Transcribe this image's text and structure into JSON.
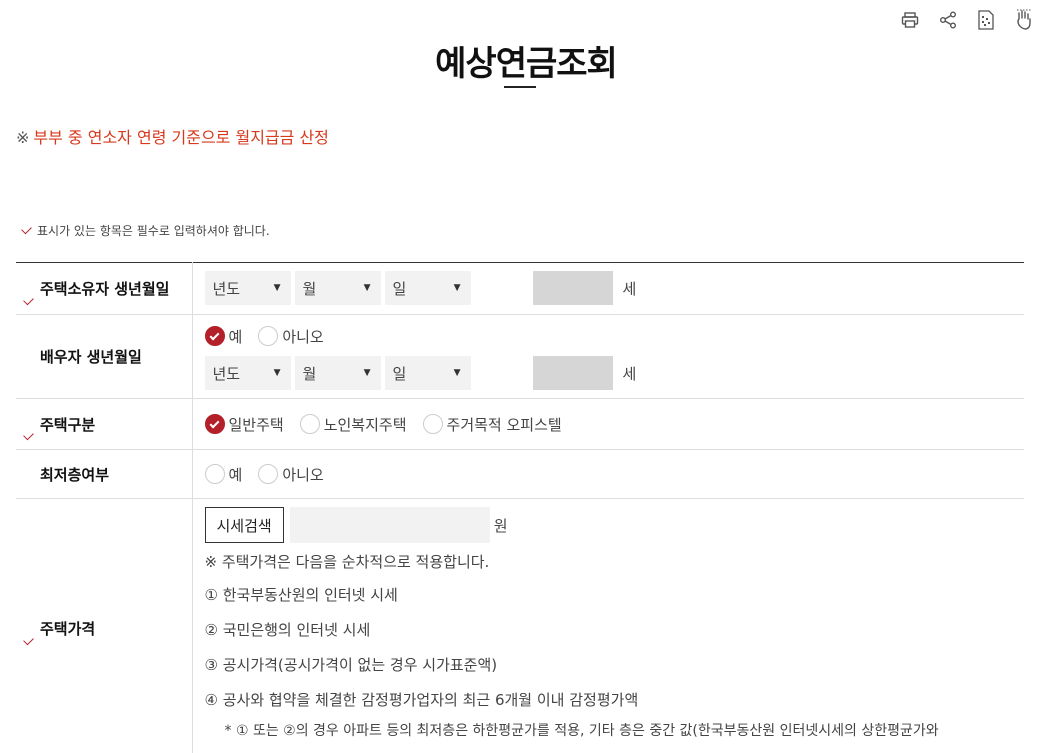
{
  "toolbar": {
    "print": "print-icon",
    "share": "share-icon",
    "qr": "qr-code-icon",
    "sign": "sign-language-icon"
  },
  "page": {
    "title": "예상연금조회",
    "notice_mark": "※",
    "notice": "부부 중 연소자 연령 기준으로 월지급금 산정",
    "required_note": "표시가 있는 항목은 필수로 입력하셔야 합니다."
  },
  "form": {
    "owner_birth": {
      "label": "주택소유자 생년월일",
      "year": "년도",
      "month": "월",
      "day": "일",
      "age_unit": "세"
    },
    "spouse_birth": {
      "label": "배우자 생년월일",
      "yes": "예",
      "no": "아니오",
      "year": "년도",
      "month": "월",
      "day": "일",
      "age_unit": "세"
    },
    "house_type": {
      "label": "주택구분",
      "options": [
        "일반주택",
        "노인복지주택",
        "주거목적 오피스텔"
      ]
    },
    "lowest_floor": {
      "label": "최저층여부",
      "yes": "예",
      "no": "아니오"
    },
    "house_price": {
      "label": "주택가격",
      "search_button": "시세검색",
      "unit": "원",
      "note": "※ 주택가격은 다음을 순차적으로 적용합니다.",
      "items": [
        "① 한국부동산원의 인터넷 시세",
        "② 국민은행의 인터넷 시세",
        "③ 공시가격(공시가격이 없는 경우 시가표준액)",
        "④ 공사와 협약을 체결한 감정평가업자의 최근 6개월 이내 감정평가액"
      ],
      "footnote": "* ① 또는 ②의 경우 아파트 등의 최저층은 하한평균가를 적용, 기타 층은 중간 값(한국부동산원 인터넷시세의 상한평균가와"
    }
  },
  "colors": {
    "accent": "#b3202a",
    "notice": "#d6391c"
  }
}
